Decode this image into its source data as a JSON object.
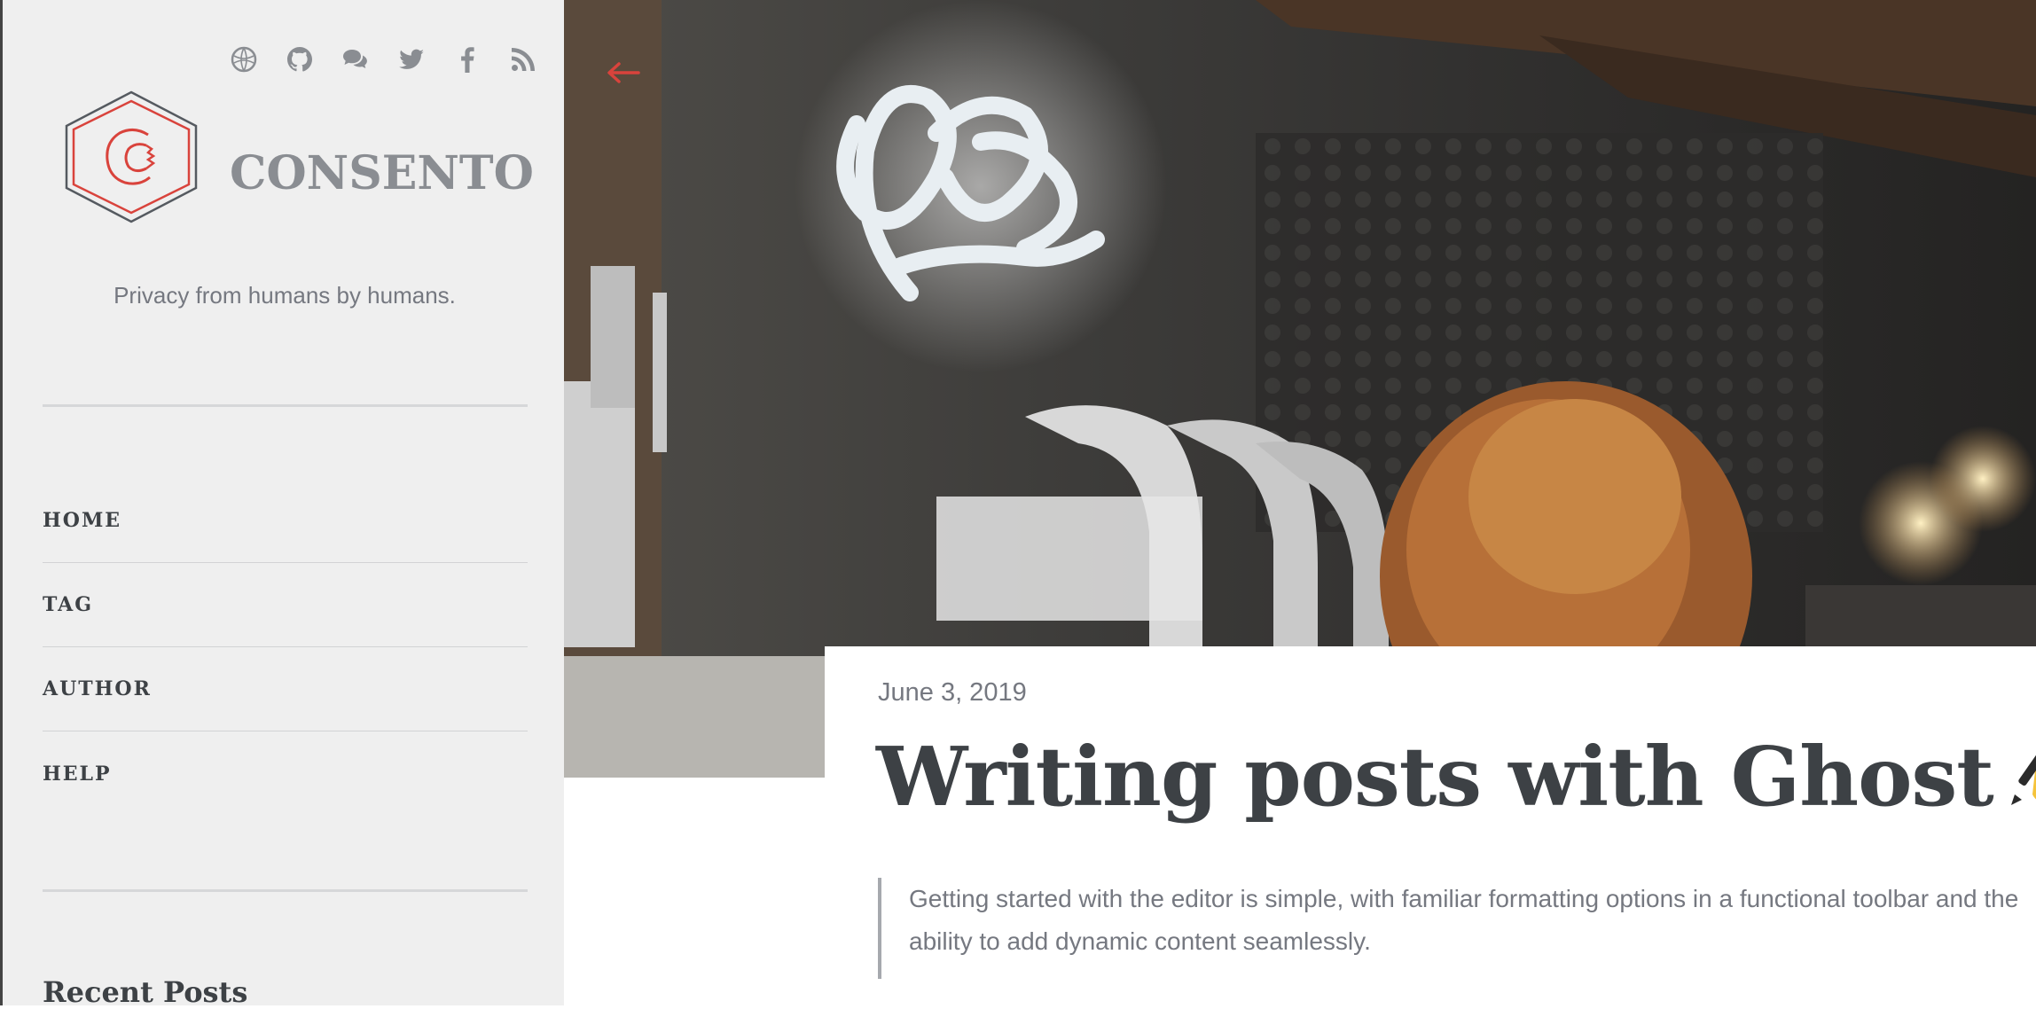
{
  "site": {
    "brand": "CONSENTO",
    "tagline": "Privacy from humans by humans.",
    "accent_color": "#d9433c",
    "social_icons": [
      "globe-icon",
      "github-icon",
      "chat-icon",
      "twitter-icon",
      "facebook-icon",
      "rss-icon"
    ]
  },
  "nav": {
    "items": [
      {
        "label": "HOME"
      },
      {
        "label": "TAG"
      },
      {
        "label": "AUTHOR"
      },
      {
        "label": "HELP"
      }
    ]
  },
  "sidebar": {
    "recent_heading": "Recent Posts"
  },
  "post": {
    "back_icon": "arrow-left-icon",
    "date": "June 3, 2019",
    "title": "Writing posts with Ghost",
    "title_emoji": "writing-hand-icon",
    "excerpt_line1": "Getting started with the editor is simple, with familiar formatting options in a functional toolbar and the",
    "excerpt_line2": "ability to add dynamic content seamlessly."
  }
}
